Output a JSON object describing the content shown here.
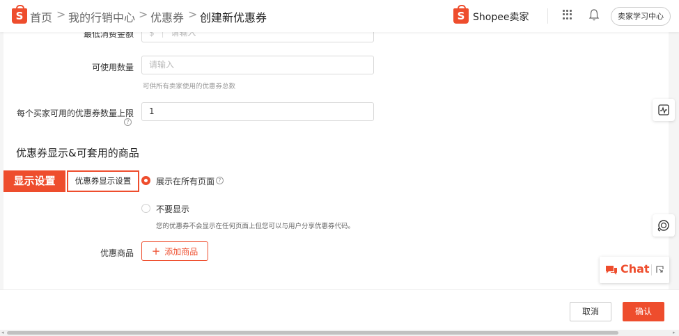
{
  "header": {
    "breadcrumb": [
      "首页",
      "我的行销中心",
      "优惠券",
      "创建新优惠券"
    ],
    "separator": ">",
    "brand": "Shopee卖家",
    "learning_center": "卖家学习中心"
  },
  "form": {
    "min_spend": {
      "label": "最低消费金额",
      "prefix": "$",
      "placeholder": "请输入"
    },
    "usage_quantity": {
      "label": "可使用数量",
      "placeholder": "请输入",
      "hint": "可供所有卖家使用的优惠券总数"
    },
    "max_per_buyer": {
      "label": "每个买家可用的优惠券数量上限",
      "value": "1"
    },
    "section_title": "优惠券显示&可套用的商品",
    "display_setting": {
      "label": "优惠券显示设置",
      "options": [
        {
          "label": "展示在所有页面",
          "selected": true
        },
        {
          "label": "不要显示",
          "selected": false
        }
      ],
      "hide_hint": "您的优惠券不会显示在任何页面上但您可以与用户分享优惠券代码。"
    },
    "products": {
      "label": "优惠商品",
      "add_button": "添加商品"
    }
  },
  "annotation": {
    "tag": "显示设置"
  },
  "chat": {
    "label": "Chat"
  },
  "footer": {
    "cancel": "取消",
    "confirm": "确认"
  },
  "colors": {
    "accent": "#ee4d2d"
  },
  "icons": [
    "shopee-logo-icon",
    "chevron-right-icon",
    "apps-grid-icon",
    "bell-icon",
    "help-icon",
    "activity-monitor-icon",
    "headset-icon",
    "chat-icon",
    "minimize-icon"
  ]
}
